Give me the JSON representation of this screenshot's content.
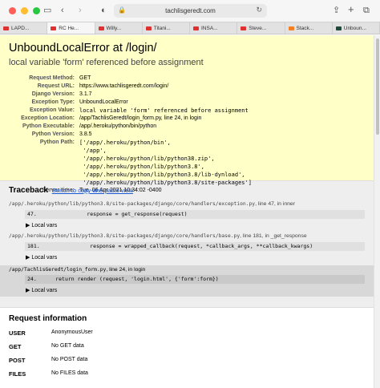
{
  "browser": {
    "url": "tachlisgeredt.com",
    "tabs": [
      {
        "label": "LAPD...",
        "icon": "youtube"
      },
      {
        "label": "RC He...",
        "icon": "youtube",
        "active": true
      },
      {
        "label": "Willy...",
        "icon": "youtube"
      },
      {
        "label": "Titani...",
        "icon": "youtube"
      },
      {
        "label": "INSA...",
        "icon": "youtube"
      },
      {
        "label": "Steve...",
        "icon": "youtube"
      },
      {
        "label": "Stack...",
        "icon": "stackoverflow"
      },
      {
        "label": "Unboun...",
        "icon": "django"
      }
    ]
  },
  "summary": {
    "title": "UnboundLocalError at /login/",
    "subtitle": "local variable 'form' referenced before assignment",
    "rows": [
      {
        "label": "Request Method:",
        "value": "GET"
      },
      {
        "label": "Request URL:",
        "value": "https://www.tachlisgeredt.com/login/"
      },
      {
        "label": "Django Version:",
        "value": "3.1.7"
      },
      {
        "label": "Exception Type:",
        "value": "UnboundLocalError"
      },
      {
        "label": "Exception Value:",
        "value": "local variable 'form' referenced before assignment"
      },
      {
        "label": "Exception Location:",
        "value": "/app/TachlisGeredt/login_form.py, line 24, in login"
      },
      {
        "label": "Python Executable:",
        "value": "/app/.heroku/python/bin/python"
      },
      {
        "label": "Python Version:",
        "value": "3.8.5"
      },
      {
        "label": "Python Path:",
        "value": "['/app/.heroku/python/bin',\n '/app',\n '/app/.heroku/python/lib/python38.zip',\n '/app/.heroku/python/lib/python3.8',\n '/app/.heroku/python/lib/python3.8/lib-dynload',\n '/app/.heroku/python/lib/python3.8/site-packages']"
      },
      {
        "label": "Server time:",
        "value": "Tue, 06 Apr 2021 10:34:02 -0400"
      }
    ]
  },
  "traceback": {
    "heading": "Traceback",
    "switch_link": "Switch to copy-and-paste view",
    "frames": [
      {
        "path": "/app/.heroku/python/lib/python3.8/site-packages/django/core/handlers/exception.py",
        "suffix": ", line 47, in inner",
        "code": "47.                response = get_response(request)",
        "localvars": "▶ Local vars"
      },
      {
        "path": "/app/.heroku/python/lib/python3.8/site-packages/django/core/handlers/base.py",
        "suffix": ", line 181, in _get_response",
        "code": "181.                response = wrapped_callback(request, *callback_args, **callback_kwargs)",
        "localvars": "▶ Local vars"
      },
      {
        "path": "/app/TachlisGeredt/login_form.py",
        "suffix": ", line 24, in login",
        "code": "24.      return render (request, 'login.html', {'form':form})",
        "localvars": "▶ Local vars"
      }
    ]
  },
  "request_info": {
    "heading": "Request information",
    "rows": [
      {
        "label": "USER",
        "value": "AnonymousUser"
      },
      {
        "label": "GET",
        "value": "No GET data"
      },
      {
        "label": "POST",
        "value": "No POST data"
      },
      {
        "label": "FILES",
        "value": "No FILES data"
      }
    ]
  }
}
